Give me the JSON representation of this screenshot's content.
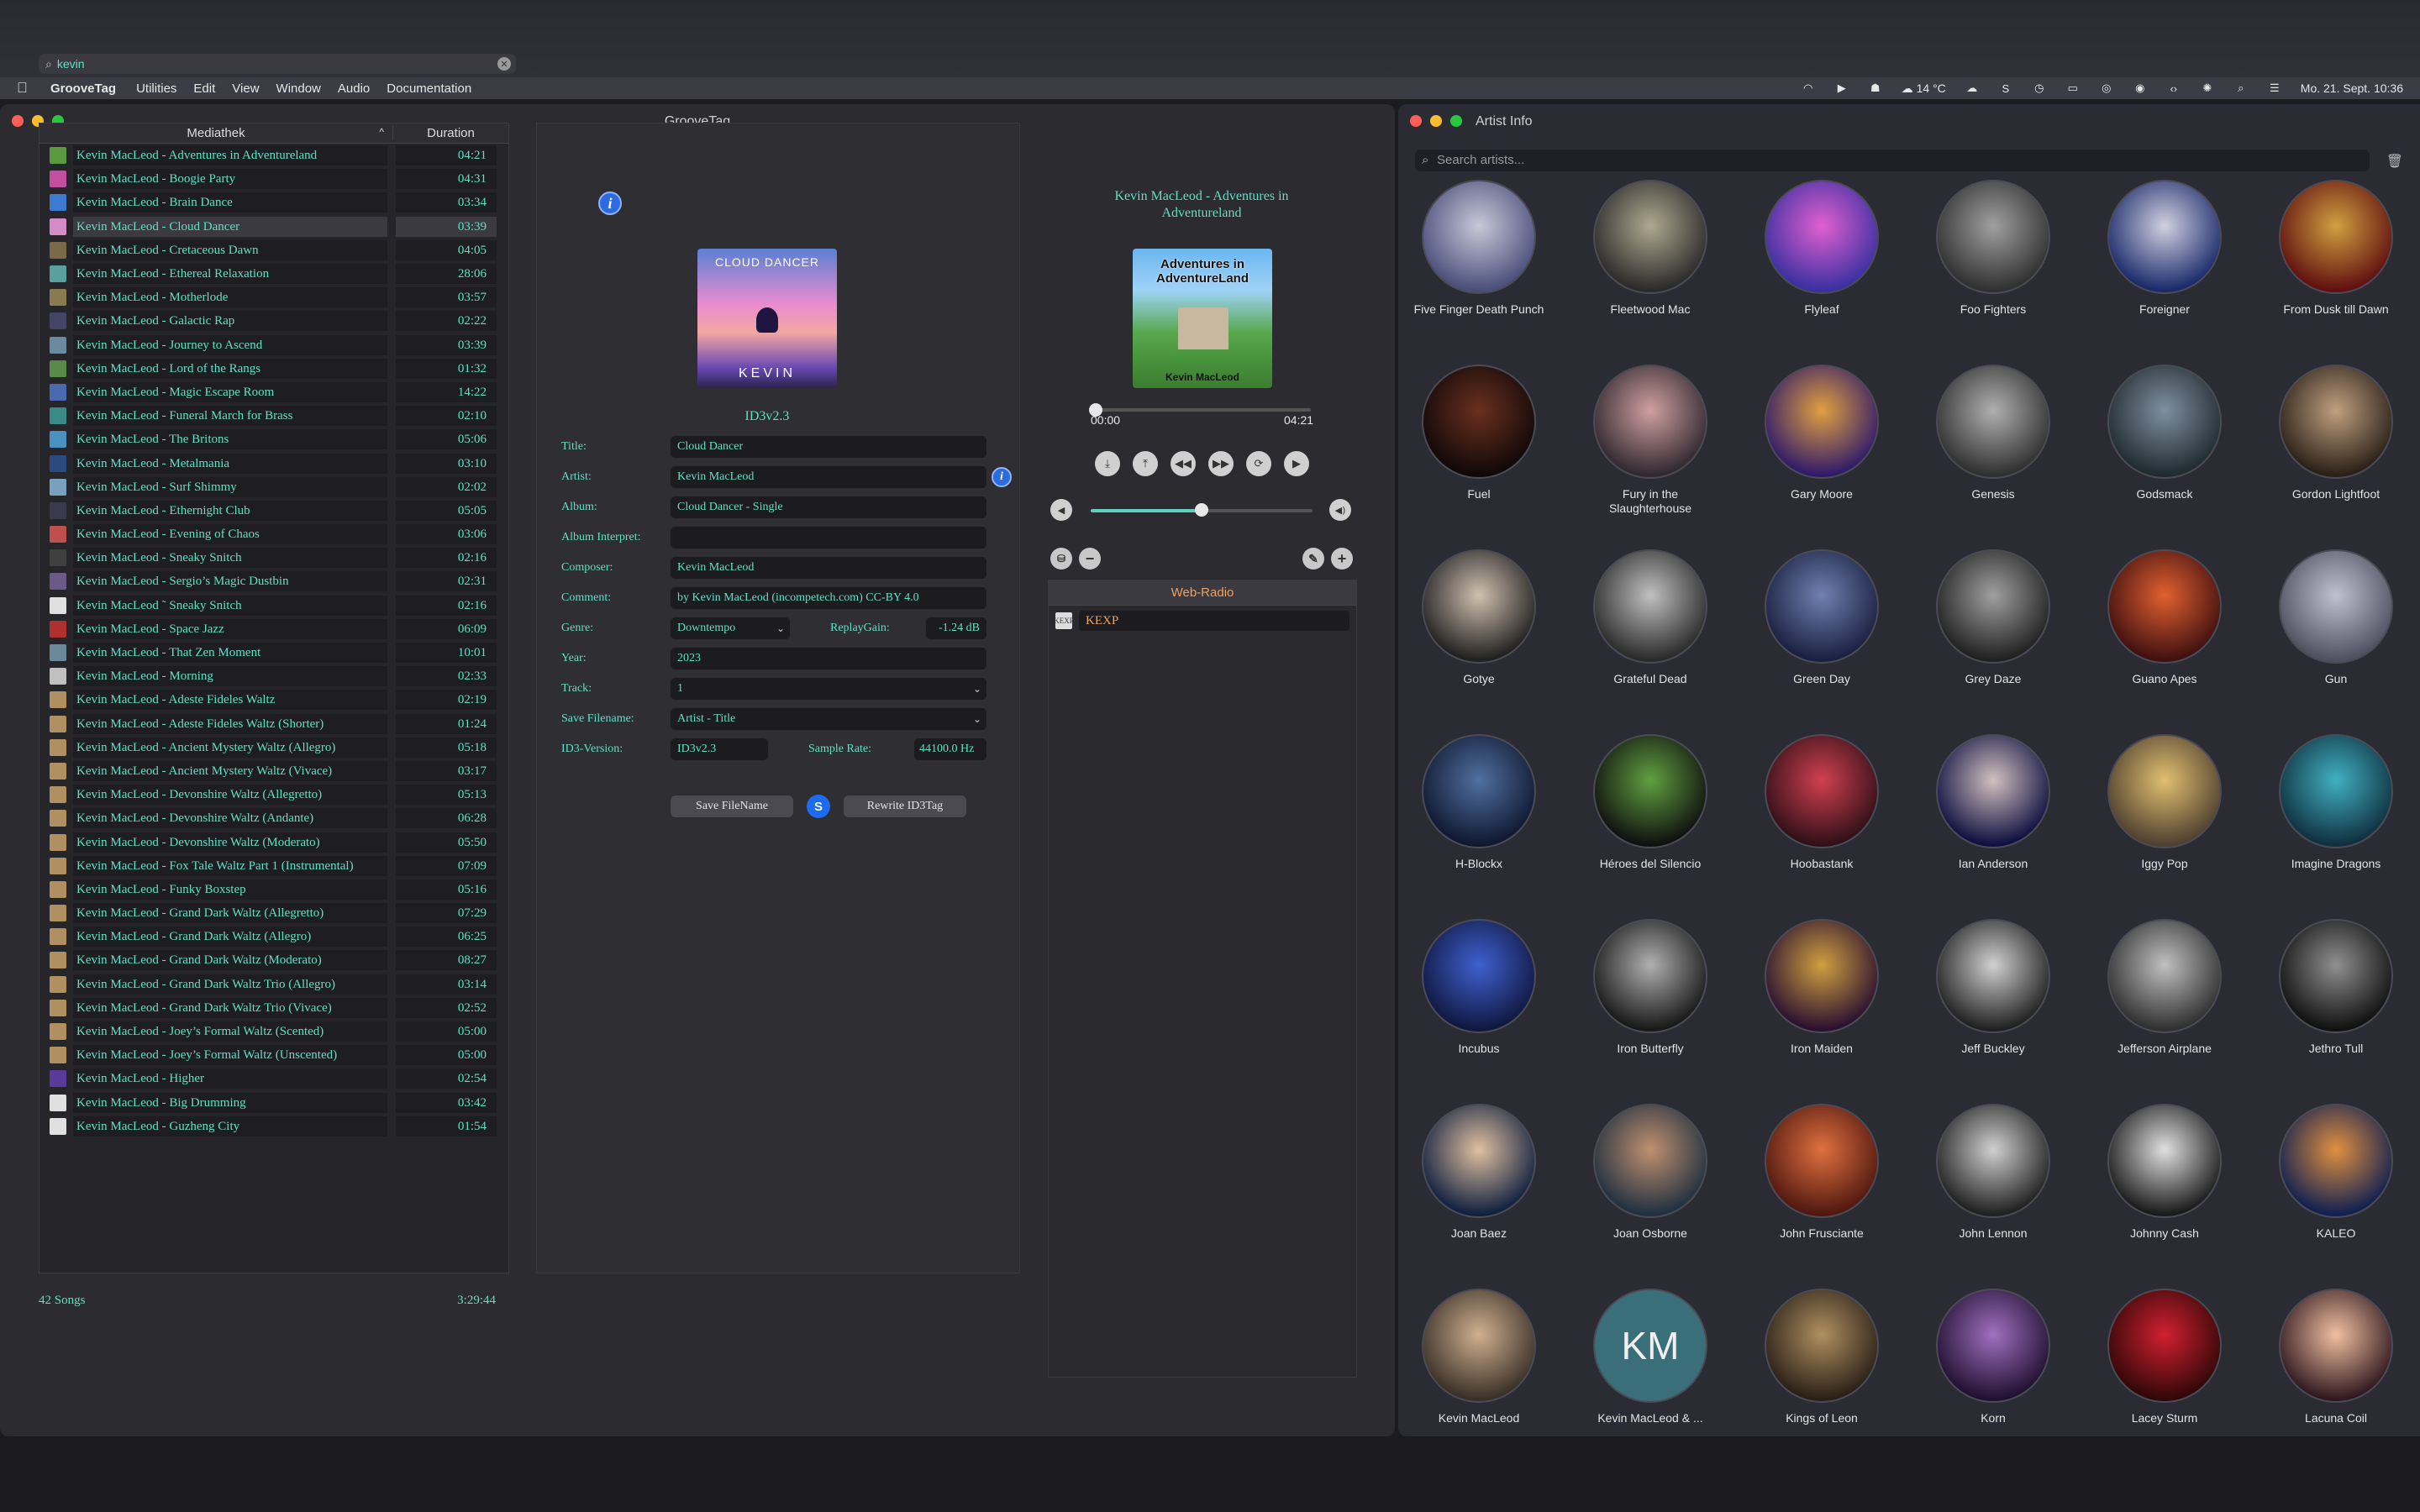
{
  "menubar": {
    "app": "GrooveTag",
    "items": [
      "Utilities",
      "Edit",
      "View",
      "Window",
      "Audio",
      "Documentation"
    ],
    "weather": "14 °C",
    "datetime": "Mo. 21. Sept.  10:36"
  },
  "main": {
    "title": "GrooveTag",
    "search_value": "kevin",
    "library": {
      "col_title": "Mediathek",
      "col_duration": "Duration",
      "rows": [
        {
          "t": "Kevin MacLeod - Adventures in Adventureland",
          "d": "04:21",
          "c": "#5b9a3e"
        },
        {
          "t": "Kevin MacLeod - Boogie Party",
          "d": "04:31",
          "c": "#c44fa0"
        },
        {
          "t": "Kevin MacLeod - Brain Dance",
          "d": "03:34",
          "c": "#3c7bd1"
        },
        {
          "t": "Kevin MacLeod - Cloud Dancer",
          "d": "03:39",
          "c": "#d58bc7"
        },
        {
          "t": "Kevin MacLeod - Cretaceous Dawn",
          "d": "04:05",
          "c": "#7a6a48"
        },
        {
          "t": "Kevin MacLeod - Ethereal Relaxation",
          "d": "28:06",
          "c": "#5ba0a0"
        },
        {
          "t": "Kevin MacLeod - Motherlode",
          "d": "03:57",
          "c": "#8a7a50"
        },
        {
          "t": "Kevin MacLeod - Galactic Rap",
          "d": "02:22",
          "c": "#444466"
        },
        {
          "t": "Kevin MacLeod - Journey to Ascend",
          "d": "03:39",
          "c": "#6a8aa0"
        },
        {
          "t": "Kevin MacLeod - Lord of the Rangs",
          "d": "01:32",
          "c": "#5a8a4a"
        },
        {
          "t": "Kevin MacLeod - Magic Escape Room",
          "d": "14:22",
          "c": "#4a6ab0"
        },
        {
          "t": "Kevin MacLeod - Funeral March for Brass",
          "d": "02:10",
          "c": "#3a8a8a"
        },
        {
          "t": "Kevin MacLeod - The Britons",
          "d": "05:06",
          "c": "#4a90c0"
        },
        {
          "t": "Kevin MacLeod - Metalmania",
          "d": "03:10",
          "c": "#2a4a80"
        },
        {
          "t": "Kevin MacLeod - Surf Shimmy",
          "d": "02:02",
          "c": "#7aa0c0"
        },
        {
          "t": "Kevin MacLeod - Ethernight Club",
          "d": "05:05",
          "c": "#3a3a4a"
        },
        {
          "t": "Kevin MacLeod - Evening of Chaos",
          "d": "03:06",
          "c": "#c05050"
        },
        {
          "t": "Kevin MacLeod - Sneaky Snitch",
          "d": "02:16",
          "c": "#404040"
        },
        {
          "t": "Kevin MacLeod - Sergio’s Magic Dustbin",
          "d": "02:31",
          "c": "#6a5a8a"
        },
        {
          "t": "Kevin MacLeod ˜ Sneaky Snitch",
          "d": "02:16",
          "c": "#e0e0e0"
        },
        {
          "t": "Kevin MacLeod - Space Jazz",
          "d": "06:09",
          "c": "#b03030"
        },
        {
          "t": "Kevin MacLeod - That Zen Moment",
          "d": "10:01",
          "c": "#6a8a9a"
        },
        {
          "t": "Kevin MacLeod - Morning",
          "d": "02:33",
          "c": "#c0c0c0"
        },
        {
          "t": "Kevin MacLeod - Adeste Fideles Waltz",
          "d": "02:19",
          "c": "#b09060"
        },
        {
          "t": "Kevin MacLeod - Adeste Fideles Waltz (Shorter)",
          "d": "01:24",
          "c": "#b09060"
        },
        {
          "t": "Kevin MacLeod - Ancient Mystery Waltz (Allegro)",
          "d": "05:18",
          "c": "#b09060"
        },
        {
          "t": "Kevin MacLeod - Ancient Mystery Waltz (Vivace)",
          "d": "03:17",
          "c": "#b09060"
        },
        {
          "t": "Kevin MacLeod - Devonshire Waltz (Allegretto)",
          "d": "05:13",
          "c": "#b09060"
        },
        {
          "t": "Kevin MacLeod - Devonshire Waltz (Andante)",
          "d": "06:28",
          "c": "#b09060"
        },
        {
          "t": "Kevin MacLeod - Devonshire Waltz (Moderato)",
          "d": "05:50",
          "c": "#b09060"
        },
        {
          "t": "Kevin MacLeod - Fox Tale Waltz Part 1 (Instrumental)",
          "d": "07:09",
          "c": "#b09060"
        },
        {
          "t": "Kevin MacLeod - Funky Boxstep",
          "d": "05:16",
          "c": "#b09060"
        },
        {
          "t": "Kevin MacLeod - Grand Dark Waltz (Allegretto)",
          "d": "07:29",
          "c": "#b09060"
        },
        {
          "t": "Kevin MacLeod - Grand Dark Waltz (Allegro)",
          "d": "06:25",
          "c": "#b09060"
        },
        {
          "t": "Kevin MacLeod - Grand Dark Waltz (Moderato)",
          "d": "08:27",
          "c": "#b09060"
        },
        {
          "t": "Kevin MacLeod - Grand Dark Waltz Trio (Allegro)",
          "d": "03:14",
          "c": "#b09060"
        },
        {
          "t": "Kevin MacLeod - Grand Dark Waltz Trio (Vivace)",
          "d": "02:52",
          "c": "#b09060"
        },
        {
          "t": "Kevin MacLeod - Joey’s Formal Waltz (Scented)",
          "d": "05:00",
          "c": "#b09060"
        },
        {
          "t": "Kevin MacLeod - Joey’s Formal Waltz (Unscented)",
          "d": "05:00",
          "c": "#b09060"
        },
        {
          "t": "Kevin MacLeod - Higher",
          "d": "02:54",
          "c": "#5a3a9a"
        },
        {
          "t": "Kevin MacLeod - Big Drumming",
          "d": "03:42",
          "c": "#e0e0e0"
        },
        {
          "t": "Kevin MacLeod - Guzheng City",
          "d": "01:54",
          "c": "#e0e0e0"
        }
      ],
      "footer_count": "42 Songs",
      "footer_total": "3:29:44"
    },
    "tags": {
      "cover_top": "CLOUD DANCER",
      "cover_bottom": "KEVIN",
      "version_heading": "ID3v2.3",
      "labels": {
        "title": "Title:",
        "artist": "Artist:",
        "album": "Album:",
        "album_interpret": "Album Interpret:",
        "composer": "Composer:",
        "comment": "Comment:",
        "genre": "Genre:",
        "replaygain": "ReplayGain:",
        "year": "Year:",
        "track": "Track:",
        "save_filename": "Save Filename:",
        "id3_version": "ID3-Version:",
        "sample_rate": "Sample Rate:"
      },
      "values": {
        "title": "Cloud Dancer",
        "artist": "Kevin MacLeod",
        "album": "Cloud Dancer - Single",
        "album_interpret": "",
        "composer": "Kevin MacLeod",
        "comment": "by Kevin MacLeod (incompetech.com) CC-BY 4.0",
        "genre": "Downtempo",
        "replaygain": "-1.24 dB",
        "year": "2023",
        "track": "1",
        "save_filename": "Artist - Title",
        "id3_version": "ID3v2.3",
        "sample_rate": "44100.0 Hz"
      },
      "save_filename_btn": "Save FileName",
      "rewrite_btn": "Rewrite ID3Tag"
    },
    "player": {
      "now_playing": "Kevin MacLeod - Adventures in Adventureland",
      "cover_top": "Adventures in AdventureLand",
      "cover_bottom": "Kevin MacLeod",
      "elapsed": "00:00",
      "total": "04:21",
      "progress": 0.0,
      "volume": 0.5,
      "radio_header": "Web-Radio",
      "station": "KEXP",
      "station_icon": "KEXP"
    }
  },
  "artist_window": {
    "title": "Artist Info",
    "search_placeholder": "Search artists...",
    "artists": [
      {
        "name": "Five Finger Death Punch",
        "c1": "#4a4f7a",
        "c2": "#c8c8d8"
      },
      {
        "name": "Fleetwood Mac",
        "c1": "#2a2a2a",
        "c2": "#b0a890"
      },
      {
        "name": "Flyleaf",
        "c1": "#3a30a0",
        "c2": "#e060d0"
      },
      {
        "name": "Foo Fighters",
        "c1": "#303030",
        "c2": "#a0a0a0"
      },
      {
        "name": "Foreigner",
        "c1": "#1a2a6a",
        "c2": "#d0d0e0"
      },
      {
        "name": "From Dusk till Dawn",
        "c1": "#601010",
        "c2": "#d0a040"
      },
      {
        "name": "Fuel",
        "c1": "#100808",
        "c2": "#6a3020"
      },
      {
        "name": "Fury in the Slaughterhouse",
        "c1": "#302830",
        "c2": "#d0a0a0"
      },
      {
        "name": "Gary Moore",
        "c1": "#301a6a",
        "c2": "#e0a040"
      },
      {
        "name": "Genesis",
        "c1": "#303030",
        "c2": "#b0b0b0"
      },
      {
        "name": "Godsmack",
        "c1": "#202a30",
        "c2": "#8090a0"
      },
      {
        "name": "Gordon Lightfoot",
        "c1": "#2a2018",
        "c2": "#c0a080"
      },
      {
        "name": "Gotye",
        "c1": "#202020",
        "c2": "#d0c0b0"
      },
      {
        "name": "Grateful Dead",
        "c1": "#2a2a2a",
        "c2": "#c0c0c0"
      },
      {
        "name": "Green Day",
        "c1": "#1a2040",
        "c2": "#7080b0"
      },
      {
        "name": "Grey Daze",
        "c1": "#202020",
        "c2": "#a0a0a0"
      },
      {
        "name": "Guano Apes",
        "c1": "#401010",
        "c2": "#e06030"
      },
      {
        "name": "Gun",
        "c1": "#505060",
        "c2": "#c0c0d0"
      },
      {
        "name": "H-Blockx",
        "c1": "#101830",
        "c2": "#5070a0"
      },
      {
        "name": "Héroes del Silencio",
        "c1": "#101010",
        "c2": "#60a040"
      },
      {
        "name": "Hoobastank",
        "c1": "#301018",
        "c2": "#d04050"
      },
      {
        "name": "Ian Anderson",
        "c1": "#101040",
        "c2": "#d0c0c0"
      },
      {
        "name": "Iggy Pop",
        "c1": "#504030",
        "c2": "#e0c070"
      },
      {
        "name": "Imagine Dragons",
        "c1": "#103040",
        "c2": "#40b0c0"
      },
      {
        "name": "Incubus",
        "c1": "#101840",
        "c2": "#4060d0"
      },
      {
        "name": "Iron Butterfly",
        "c1": "#181818",
        "c2": "#b0b0b0"
      },
      {
        "name": "Iron Maiden",
        "c1": "#2a1030",
        "c2": "#d0a040"
      },
      {
        "name": "Jeff Buckley",
        "c1": "#202020",
        "c2": "#d0d0d0"
      },
      {
        "name": "Jefferson Airplane",
        "c1": "#303030",
        "c2": "#c0c0c0"
      },
      {
        "name": "Jethro Tull",
        "c1": "#101010",
        "c2": "#909090"
      },
      {
        "name": "Joan Baez",
        "c1": "#102040",
        "c2": "#e0c0a0"
      },
      {
        "name": "Joan Osborne",
        "c1": "#203040",
        "c2": "#c09070"
      },
      {
        "name": "John Frusciante",
        "c1": "#501810",
        "c2": "#e07040"
      },
      {
        "name": "John Lennon",
        "c1": "#202020",
        "c2": "#d0d0d0"
      },
      {
        "name": "Johnny Cash",
        "c1": "#1a1a1a",
        "c2": "#e0e0e0"
      },
      {
        "name": "KALEO",
        "c1": "#102050",
        "c2": "#e09040"
      },
      {
        "name": "Kevin MacLeod",
        "c1": "#3a3028",
        "c2": "#d0b090"
      },
      {
        "name": "Kevin MacLeod & ...",
        "c1": "#3a6e78",
        "c2": "#4a7e88",
        "mono": "KM"
      },
      {
        "name": "Kings of Leon",
        "c1": "#2a2018",
        "c2": "#b09060"
      },
      {
        "name": "Korn",
        "c1": "#201030",
        "c2": "#a070c0"
      },
      {
        "name": "Lacey Sturm",
        "c1": "#300808",
        "c2": "#d02030"
      },
      {
        "name": "Lacuna Coil",
        "c1": "#301820",
        "c2": "#f0c0a0"
      }
    ]
  }
}
